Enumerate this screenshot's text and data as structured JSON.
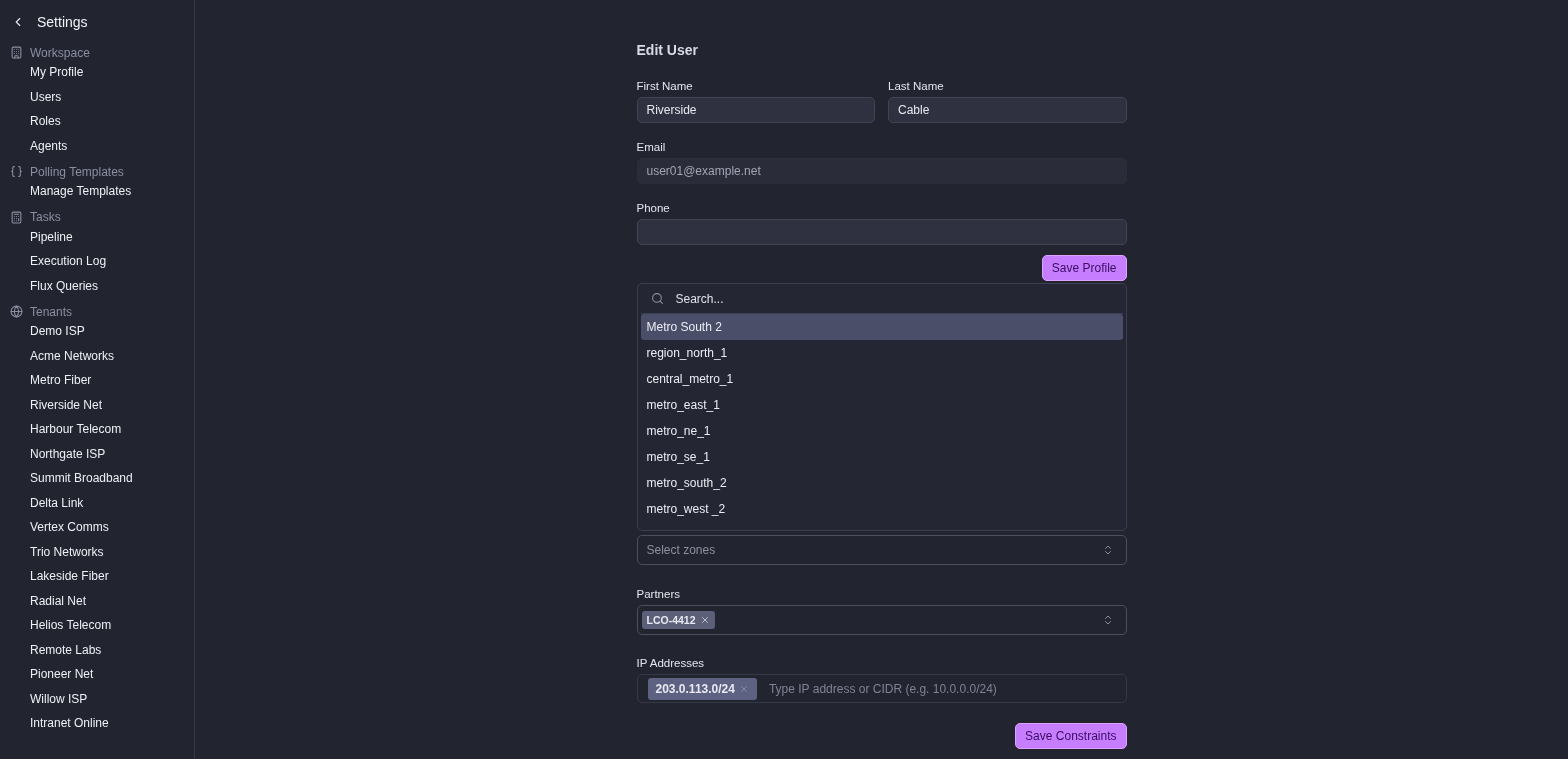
{
  "sidebar": {
    "title": "Settings",
    "sections": [
      {
        "heading": "Workspace",
        "items": [
          {
            "label": "My Profile"
          },
          {
            "label": "Users"
          },
          {
            "label": "Roles"
          },
          {
            "label": "Agents"
          }
        ]
      },
      {
        "heading": "Polling Templates",
        "items": [
          {
            "label": "Manage Templates"
          }
        ]
      },
      {
        "heading": "Tasks",
        "items": [
          {
            "label": "Pipeline"
          },
          {
            "label": "Execution Log"
          },
          {
            "label": "Flux Queries"
          }
        ]
      },
      {
        "heading": "Tenants",
        "items": [
          {
            "label": "Demo ISP"
          },
          {
            "label": "Acme Networks"
          },
          {
            "label": "Metro Fiber"
          },
          {
            "label": "Riverside Net"
          },
          {
            "label": "Harbour Telecom"
          },
          {
            "label": "Northgate ISP"
          },
          {
            "label": "Summit Broadband"
          },
          {
            "label": "Delta Link"
          },
          {
            "label": "Vertex Comms"
          },
          {
            "label": "Trio Networks"
          },
          {
            "label": "Lakeside Fiber"
          },
          {
            "label": "Radial Net"
          },
          {
            "label": "Helios Telecom"
          },
          {
            "label": "Remote Labs"
          },
          {
            "label": "Pioneer Net"
          },
          {
            "label": "Willow ISP"
          },
          {
            "label": "Intranet Online"
          }
        ]
      }
    ]
  },
  "form": {
    "title": "Edit User",
    "first_name": {
      "label": "First Name",
      "value": "Riverside"
    },
    "last_name": {
      "label": "Last Name",
      "value": "Cable"
    },
    "email": {
      "label": "Email",
      "value": "user01@example.net",
      "disabled": true
    },
    "phone": {
      "label": "Phone"
    },
    "save_profile": "Save Profile",
    "zone_dropdown": {
      "placeholder": "Search...",
      "options": [
        {
          "label": "Metro South 2",
          "selected": true
        },
        {
          "label": "region_north_1",
          "selected": false
        },
        {
          "label": "central_metro_1",
          "selected": false
        },
        {
          "label": "metro_east_1",
          "selected": false
        },
        {
          "label": "metro_ne_1",
          "selected": false
        },
        {
          "label": "metro_se_1",
          "selected": false
        },
        {
          "label": "metro_south_2",
          "selected": false
        },
        {
          "label": "metro_west _2",
          "selected": false
        }
      ]
    },
    "zones": {
      "placeholder": "Select zones"
    },
    "partners": {
      "label": "Partners",
      "tags": [
        "LCO-4412"
      ]
    },
    "ip_addresses": {
      "label": "IP Addresses",
      "tags": [
        "203.0.113.0/24"
      ],
      "placeholder": "Type IP address or CIDR (e.g. 10.0.0.0/24)"
    },
    "save_constraints": "Save Constraints"
  }
}
